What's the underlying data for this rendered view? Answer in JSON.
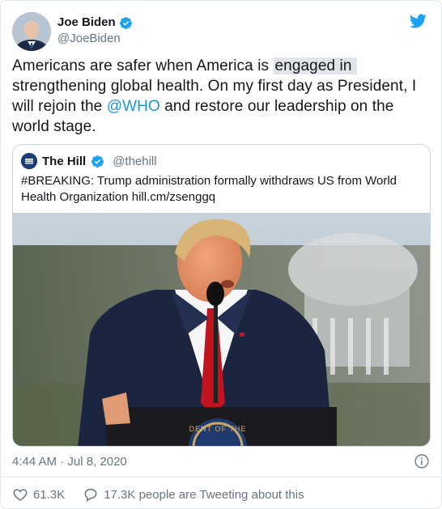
{
  "tweet": {
    "author": {
      "display_name": "Joe Biden",
      "handle": "@JoeBiden",
      "verified": true,
      "avatar_icon": "profile-photo"
    },
    "text_parts": {
      "before_highlight": "Americans are safer when America is ",
      "highlight": "engaged in",
      "middle": " strengthening global health. On my first day as President, I will rejoin the ",
      "mention": "@WHO",
      "after_mention": " and restore our leadership on the world stage."
    },
    "timestamp": "4:44 AM · Jul 8, 2020",
    "likes": "61.3K",
    "tweeting_count": "17.3K people are Tweeting about this"
  },
  "quoted_tweet": {
    "display_name": "The Hill",
    "handle": "@thehill",
    "verified": true,
    "logo_text": "THE HILL",
    "text": "#BREAKING: Trump administration formally withdraws US from World Health Organization hill.cm/zsenggq",
    "image_seal_text": "DENT OF THE"
  },
  "colors": {
    "twitter_blue": "#1da1f2",
    "link_blue": "#1b95e0",
    "secondary_text": "#657786",
    "border": "#e1e8ed",
    "highlight_bg": "#e1e4e8"
  },
  "icons": [
    "twitter-bird-icon",
    "verified-badge-icon",
    "info-icon",
    "heart-icon",
    "reply-bubble-icon"
  ]
}
